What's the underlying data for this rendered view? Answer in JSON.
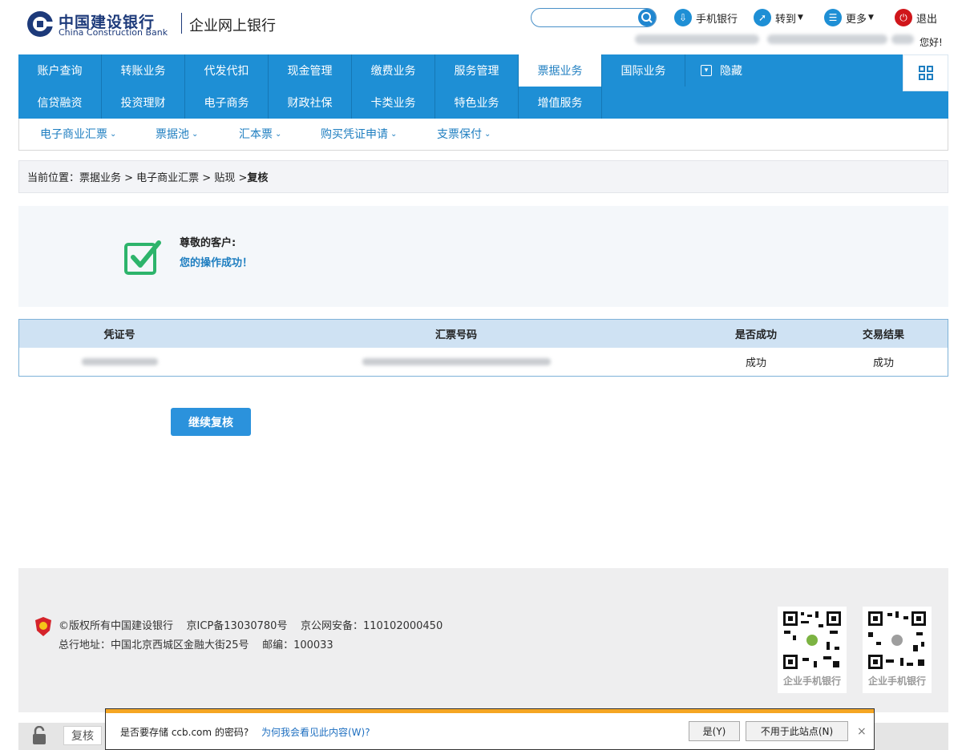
{
  "header": {
    "logo_cn": "中国建设银行",
    "logo_en": "China Construction Bank",
    "logo_sub": "企业网上银行",
    "mobile_bank": "手机银行",
    "goto": "转到",
    "more": "更多",
    "logout": "退出",
    "greeting": "您好!"
  },
  "nav": {
    "row1": [
      "账户查询",
      "转账业务",
      "代发代扣",
      "现金管理",
      "缴费业务",
      "服务管理",
      "票据业务",
      "国际业务"
    ],
    "row2": [
      "信贷融资",
      "投资理财",
      "电子商务",
      "财政社保",
      "卡类业务",
      "特色业务",
      "增值服务"
    ],
    "hide": "隐藏"
  },
  "subnav": [
    "电子商业汇票",
    "票据池",
    "汇本票",
    "购买凭证申请",
    "支票保付"
  ],
  "breadcrumb": {
    "prefix": "当前位置：票据业务 > 电子商业汇票 > 贴现 > ",
    "current": "复核"
  },
  "success": {
    "title": "尊敬的客户:",
    "message": "您的操作成功！"
  },
  "table": {
    "headers": [
      "凭证号",
      "汇票号码",
      "是否成功",
      "交易结果"
    ],
    "row": {
      "success": "成功",
      "result": "成功"
    }
  },
  "continue_button": "继续复核",
  "footer": {
    "line1": "©版权所有中国建设银行    京ICP备13030780号    京公网安备：110102000450",
    "line2": "总行地址：中国北京西城区金融大街25号    邮编：100033",
    "qr_android": "企业手机银行",
    "qr_ios": "企业手机银行"
  },
  "statusbar": {
    "tab": "复核"
  },
  "password_bar": {
    "question": "是否要存储 ccb.com 的密码?",
    "why": "为何我会看见此内容(W)?",
    "yes": "是(Y)",
    "never": "不用于此站点(N)",
    "close": "×"
  },
  "colors": {
    "brand_blue": "#1e8fd5",
    "success_green": "#2db46b",
    "dialog_accent": "#f5a623"
  }
}
